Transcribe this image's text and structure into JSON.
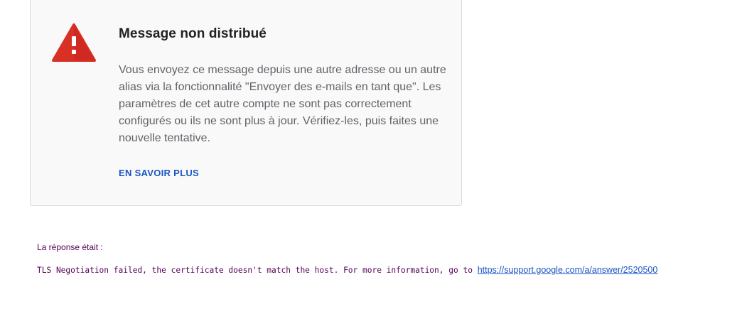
{
  "card": {
    "icon": "warning-triangle-icon",
    "icon_color": "#d93025",
    "title": "Message non distribué",
    "body": "Vous envoyez ce message depuis une autre adresse ou un autre alias via la fonctionnalité \"Envoyer des e-mails en tant que\". Les paramètres de cet autre compte ne sont pas correctement configurés ou ils ne sont plus à jour. Vérifiez-les, puis faites une nouvelle tentative.",
    "learn_more_label": "EN SAVOIR PLUS",
    "background_color": "#f9f9f9"
  },
  "response": {
    "label": "La réponse était :",
    "message": "TLS Negotiation failed, the certificate doesn't match the host. For more information, go to",
    "link_text": "https://support.google.com/a/answer/2520500",
    "text_color": "#550055"
  },
  "colors": {
    "link": "#1a56c4",
    "title": "#202124",
    "body": "#5f6368"
  }
}
